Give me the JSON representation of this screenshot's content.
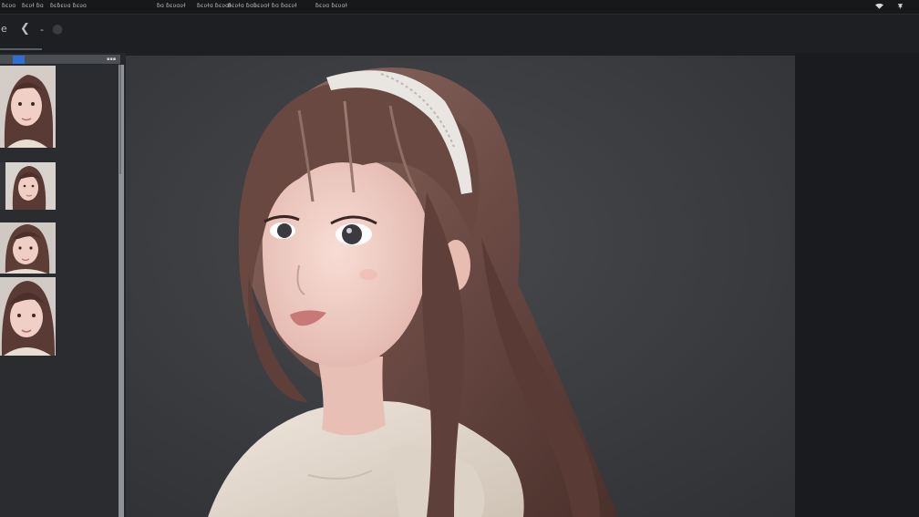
{
  "menubar": {
    "items": [
      "ɓɛʋɑ",
      "ɓɛʋɫ ɓɑ",
      "ɓɛɓɛʋɑ ɓɛʋɑ",
      "ɓɑ ɓɛʋɑʋɫ",
      "ɓɛʋɫɑ ɓɛʋɑɫ",
      "ɓɛʋɫɑ ɓɑʋ",
      "ɓɛʋɑɫ ɓɑ ɓɑɛʋɫ",
      "ɓɛʋɑ ɓɛʋɑɫ"
    ],
    "tray_icons": [
      "wifi-icon",
      "pin-icon"
    ]
  },
  "toolstrip": {
    "tools": [
      {
        "icon": "eye-icon",
        "glyph": "e"
      },
      {
        "icon": "back-icon",
        "glyph": "❮"
      },
      {
        "icon": "minus-icon",
        "glyph": "-"
      },
      {
        "icon": "circle-icon",
        "glyph": "●"
      }
    ]
  },
  "left_panel": {
    "zoom_fraction": 0.13,
    "thumbnails": [
      {
        "label": "portrait-1"
      },
      {
        "label": "portrait-2"
      },
      {
        "label": "portrait-3"
      },
      {
        "label": "portrait-4"
      }
    ]
  },
  "colors": {
    "accent": "#2f6fd1",
    "background": "#1d1f22",
    "canvas_backdrop": "#3a3c40",
    "hair": "#6b4a44",
    "skin": "#eec9bf",
    "sweater": "#e7ddd1"
  }
}
